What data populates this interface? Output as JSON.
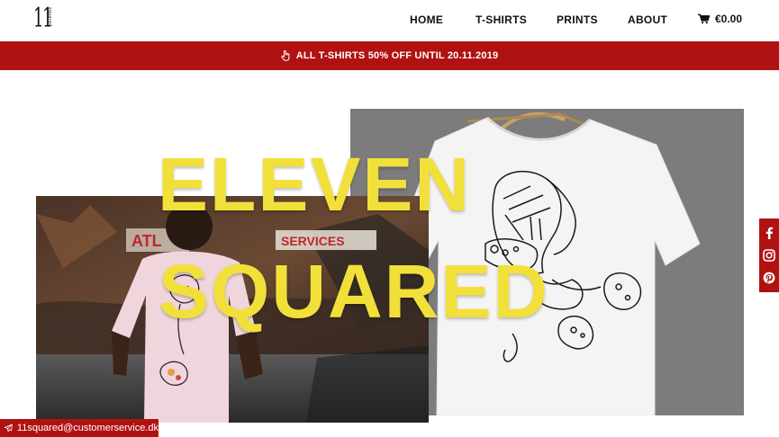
{
  "brand": {
    "logo_main": "11",
    "logo_sub": "squared"
  },
  "nav": {
    "home": "HOME",
    "tshirts": "T-SHIRTS",
    "prints": "PRINTS",
    "about": "ABOUT"
  },
  "cart": {
    "total": "€0.00",
    "icon": "shopping-cart-icon"
  },
  "promo": {
    "text": "ALL T-SHIRTS 50% OFF UNTIL 20.11.2019",
    "icon": "pointing-hand-icon"
  },
  "hero": {
    "line1": "ELEVEN",
    "line2": "SQUARED"
  },
  "photos": {
    "street_sign": "SERVICES",
    "street_sign_left": "ATL"
  },
  "social": {
    "icons": [
      "facebook-icon",
      "instagram-icon",
      "pinterest-icon"
    ]
  },
  "contact": {
    "email": "11squared@customerservice.dk",
    "icon": "paper-plane-icon"
  },
  "colors": {
    "accent_red": "#b01212",
    "hero_yellow": "#f2e03a",
    "grey_panel": "#7c7c7c"
  }
}
